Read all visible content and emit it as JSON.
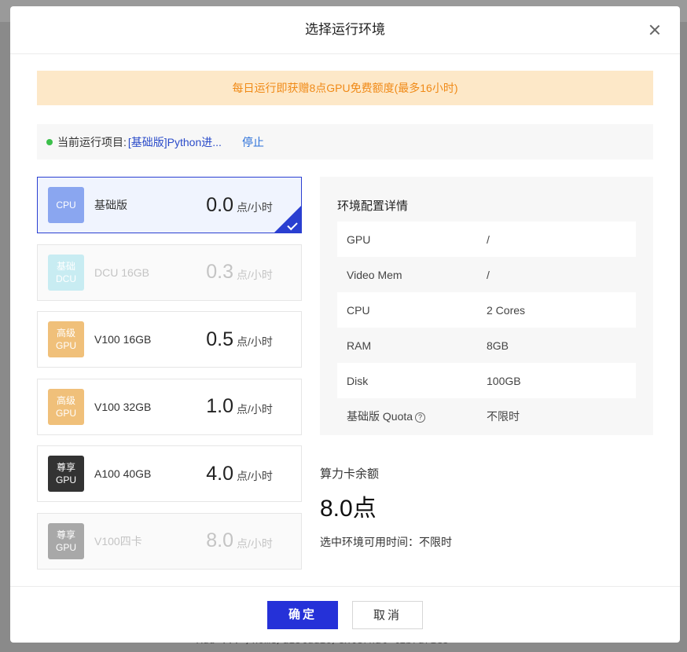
{
  "background": {
    "bottom_text": "Add ... /home/aistudio/external-libraries"
  },
  "modal": {
    "title": "选择运行环境",
    "notice": "每日运行即获赠8点GPU免费额度(最多16小时)",
    "current": {
      "label": "当前运行项目:",
      "project": "[基础版]Python进...",
      "stop": "停止"
    },
    "environments": [
      {
        "icon_line1": "CPU",
        "icon_line2": "",
        "name": "基础版",
        "price": "0.0",
        "unit": "点/小时",
        "selected": true,
        "disabled": false,
        "icon_color": "#8aa6f0"
      },
      {
        "icon_line1": "基础",
        "icon_line2": "DCU",
        "name": "DCU 16GB",
        "price": "0.3",
        "unit": "点/小时",
        "selected": false,
        "disabled": true,
        "icon_color": "#c8ecf2"
      },
      {
        "icon_line1": "高级",
        "icon_line2": "GPU",
        "name": "V100 16GB",
        "price": "0.5",
        "unit": "点/小时",
        "selected": false,
        "disabled": false,
        "icon_color": "#f0c07a"
      },
      {
        "icon_line1": "高级",
        "icon_line2": "GPU",
        "name": "V100 32GB",
        "price": "1.0",
        "unit": "点/小时",
        "selected": false,
        "disabled": false,
        "icon_color": "#f0c07a"
      },
      {
        "icon_line1": "尊享",
        "icon_line2": "GPU",
        "name": "A100 40GB",
        "price": "4.0",
        "unit": "点/小时",
        "selected": false,
        "disabled": false,
        "icon_color": "#333333"
      },
      {
        "icon_line1": "尊享",
        "icon_line2": "GPU",
        "name": "V100四卡",
        "price": "8.0",
        "unit": "点/小时",
        "selected": false,
        "disabled": true,
        "icon_color": "#a8a8a8"
      }
    ],
    "details": {
      "title": "环境配置详情",
      "rows": [
        {
          "key": "GPU",
          "value": "/"
        },
        {
          "key": "Video Mem",
          "value": "/"
        },
        {
          "key": "CPU",
          "value": "2 Cores"
        },
        {
          "key": "RAM",
          "value": "8GB"
        },
        {
          "key": "Disk",
          "value": "100GB"
        },
        {
          "key": "基础版 Quota",
          "value": "不限时"
        }
      ]
    },
    "balance_label": "算力卡余额",
    "balance_value": "8.0点",
    "available_time": "选中环境可用时间：不限时",
    "ok_button": "确定",
    "cancel_button": "取消",
    "colors": {
      "primary": "#2531d8",
      "notice_bg": "#fde8c8",
      "notice_text": "#f08a17",
      "link": "#2a6fd9"
    }
  }
}
